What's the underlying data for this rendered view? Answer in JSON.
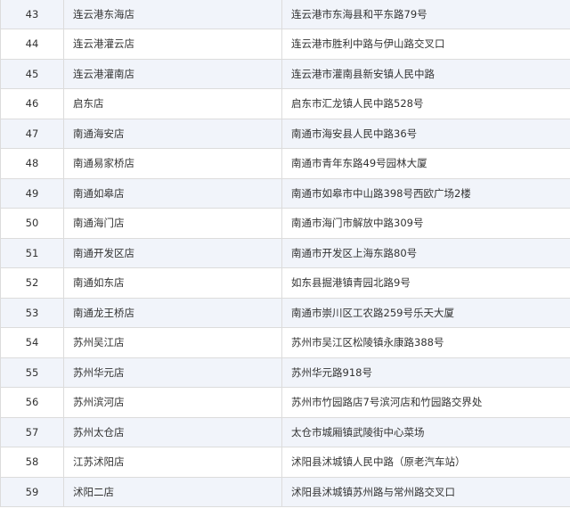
{
  "table": {
    "rows": [
      {
        "num": "43",
        "name": "连云港东海店",
        "address": "连云港市东海县和平东路79号"
      },
      {
        "num": "44",
        "name": "连云港灌云店",
        "address": "连云港市胜利中路与伊山路交叉口"
      },
      {
        "num": "45",
        "name": "连云港灌南店",
        "address": "连云港市灌南县新安镇人民中路"
      },
      {
        "num": "46",
        "name": "启东店",
        "address": "启东市汇龙镇人民中路528号"
      },
      {
        "num": "47",
        "name": "南通海安店",
        "address": "南通市海安县人民中路36号"
      },
      {
        "num": "48",
        "name": "南通易家桥店",
        "address": "南通市青年东路49号园林大厦"
      },
      {
        "num": "49",
        "name": "南通如皋店",
        "address": "南通市如皋市中山路398号西欧广场2楼"
      },
      {
        "num": "50",
        "name": "南通海门店",
        "address": "南通市海门市解放中路309号"
      },
      {
        "num": "51",
        "name": "南通开发区店",
        "address": "南通市开发区上海东路80号"
      },
      {
        "num": "52",
        "name": "南通如东店",
        "address": "如东县掘港镇青园北路9号"
      },
      {
        "num": "53",
        "name": "南通龙王桥店",
        "address": "南通市崇川区工农路259号乐天大厦"
      },
      {
        "num": "54",
        "name": "苏州吴江店",
        "address": "苏州市吴江区松陵镇永康路388号"
      },
      {
        "num": "55",
        "name": "苏州华元店",
        "address": "苏州华元路918号"
      },
      {
        "num": "56",
        "name": "苏州滨河店",
        "address": "苏州市竹园路店7号滨河店和竹园路交界处"
      },
      {
        "num": "57",
        "name": "苏州太仓店",
        "address": "太仓市城厢镇武陵街中心菜场"
      },
      {
        "num": "58",
        "name": "江苏沭阳店",
        "address": "沭阳县沭城镇人民中路（原老汽车站）"
      },
      {
        "num": "59",
        "name": "沭阳二店",
        "address": "沭阳县沭城镇苏州路与常州路交叉口"
      }
    ]
  },
  "colors": {
    "row_stripe": "#f1f4fa",
    "row_plain": "#ffffff",
    "border": "#dcdcdc",
    "text": "#333333"
  }
}
